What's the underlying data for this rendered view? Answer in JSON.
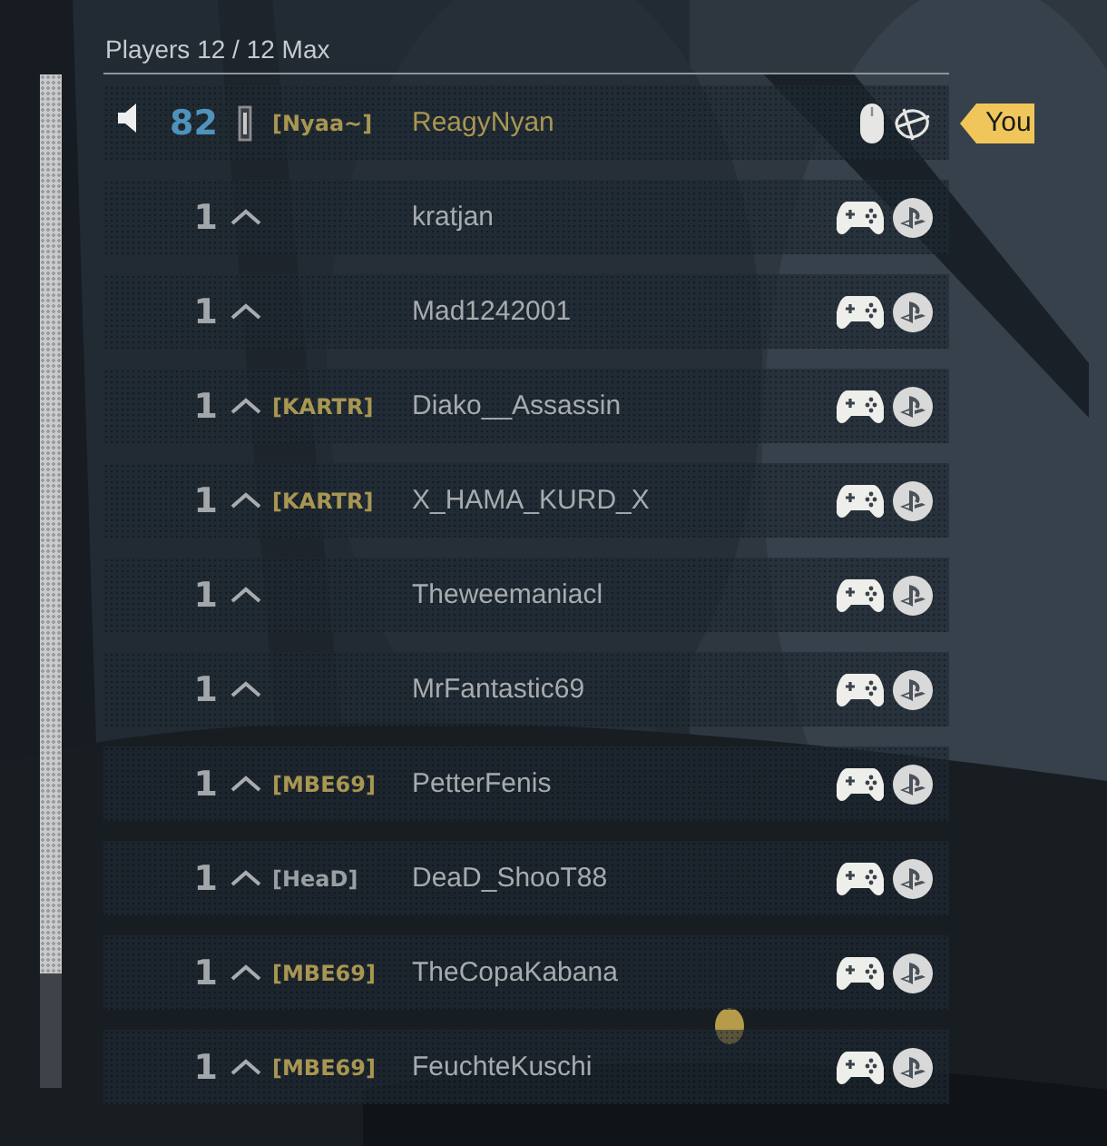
{
  "header": {
    "title": "Players 12 / 12 Max"
  },
  "players": [
    {
      "voice": true,
      "level": "82",
      "self": true,
      "rank": {
        "kind": "bar"
      },
      "clan": {
        "text": "[Nyaa~]",
        "color": "#a89652"
      },
      "name": "ReagyNyan",
      "input": {
        "kind": "mouse"
      },
      "platform": {
        "kind": "battlenet"
      },
      "tag": "You"
    },
    {
      "voice": false,
      "level": "1",
      "self": false,
      "rank": {
        "kind": "chevron"
      },
      "name": "kratjan",
      "input": {
        "kind": "controller"
      },
      "platform": {
        "kind": "playstation"
      }
    },
    {
      "voice": false,
      "level": "1",
      "self": false,
      "rank": {
        "kind": "chevron"
      },
      "name": "Mad1242001",
      "input": {
        "kind": "controller"
      },
      "platform": {
        "kind": "playstation"
      }
    },
    {
      "voice": false,
      "level": "1",
      "self": false,
      "rank": {
        "kind": "chevron"
      },
      "clan": {
        "text": "[KARTR]",
        "color": "#a89652"
      },
      "name": "Diako__Assassin",
      "input": {
        "kind": "controller"
      },
      "platform": {
        "kind": "playstation"
      }
    },
    {
      "voice": false,
      "level": "1",
      "self": false,
      "rank": {
        "kind": "chevron"
      },
      "clan": {
        "text": "[KARTR]",
        "color": "#a89652"
      },
      "name": "X_HAMA_KURD_X",
      "input": {
        "kind": "controller"
      },
      "platform": {
        "kind": "playstation"
      }
    },
    {
      "voice": false,
      "level": "1",
      "self": false,
      "rank": {
        "kind": "chevron"
      },
      "name": "Theweemaniacl",
      "input": {
        "kind": "controller"
      },
      "platform": {
        "kind": "playstation"
      }
    },
    {
      "voice": false,
      "level": "1",
      "self": false,
      "rank": {
        "kind": "chevron"
      },
      "name": "MrFantastic69",
      "input": {
        "kind": "controller"
      },
      "platform": {
        "kind": "playstation"
      }
    },
    {
      "voice": false,
      "level": "1",
      "self": false,
      "rank": {
        "kind": "chevron"
      },
      "clan": {
        "text": "[MBE69]",
        "color": "#a89652"
      },
      "name": "PetterFenis",
      "input": {
        "kind": "controller"
      },
      "platform": {
        "kind": "playstation"
      }
    },
    {
      "voice": false,
      "level": "1",
      "self": false,
      "rank": {
        "kind": "chevron"
      },
      "clan": {
        "text": "[HeaD]",
        "color": "#9a9fa4"
      },
      "name": "DeaD_ShooT88",
      "input": {
        "kind": "controller"
      },
      "platform": {
        "kind": "playstation"
      }
    },
    {
      "voice": false,
      "level": "1",
      "self": false,
      "rank": {
        "kind": "chevron"
      },
      "clan": {
        "text": "[MBE69]",
        "color": "#a89652"
      },
      "name": "TheCopaKabana",
      "input": {
        "kind": "controller"
      },
      "platform": {
        "kind": "playstation"
      }
    },
    {
      "voice": false,
      "level": "1",
      "self": false,
      "rank": {
        "kind": "chevron"
      },
      "clan": {
        "text": "[MBE69]",
        "color": "#a89652"
      },
      "name": "FeuchteKuschi",
      "input": {
        "kind": "controller"
      },
      "platform": {
        "kind": "playstation"
      }
    }
  ]
}
